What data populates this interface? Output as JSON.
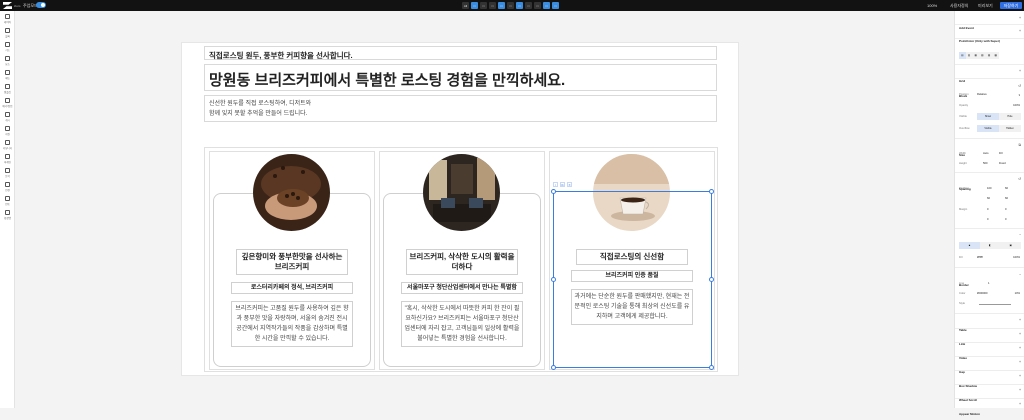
{
  "topbar": {
    "logo_text": "zium",
    "realtime_label": "주업모드",
    "devices": [
      "All",
      "□",
      "□",
      "□",
      "□",
      "□",
      "□",
      "□",
      "□",
      "□",
      "□"
    ],
    "zoom": "100%",
    "link_1": "사용자정의",
    "link_2": "미리보기",
    "publish": "저장하기"
  },
  "leftbar": {
    "items": [
      {
        "label": "레이어"
      },
      {
        "label": "블록"
      },
      {
        "label": "기능"
      },
      {
        "label": "요소"
      },
      {
        "label": "메뉴"
      },
      {
        "label": "템플릿"
      },
      {
        "label": "배너/팝업"
      },
      {
        "label": "게시"
      },
      {
        "label": "자원"
      },
      {
        "label": "커뮤니티"
      },
      {
        "label": "마케팅"
      },
      {
        "label": "분석"
      },
      {
        "label": "연결"
      },
      {
        "label": "연동"
      },
      {
        "label": "확장앱"
      }
    ]
  },
  "canvas": {
    "subtitle": "직접로스팅 원두, 풍부한 커피향을 선사합니다.",
    "headline": "망원동 브리즈커피에서 특별한 로스팅 경험을 만끽하세요.",
    "description_line1": "신선한 원두를 직접 로스팅하여, 디저트와",
    "description_line2": "함께 잊지 못할 추억을 만들어 드립니다.",
    "cards": [
      {
        "title": "깊은향미와 풍부한맛을 선사하는 브리즈커피",
        "subtitle": "로스터리카페의 정석, 브리즈커피",
        "body": "브리즈커피는 고품질 원두를 사용하여 깊은 향과 풍부한 맛을 자랑하며, 서울의 숨겨진 전시 공간에서 지역작가들의 작품을 감상하며 특별한 시간을 만끽할 수 있습니다."
      },
      {
        "title": "브리즈커피, 삭삭한 도시의 활력을 더하다",
        "subtitle": "서울마포구 청단산업센터에서 만나는 특별함",
        "body": "\"혹시, 삭삭한 도시에서 따뜻한 커피 한 잔이 필요하신가요? 브리즈커피는 서울마포구 청단산업센터에 자리 잡고, 고객님들의 일상에 활력을 불어넣는 특별한 경험을 선사합니다."
      },
      {
        "title": "직접로스팅의 신선함",
        "subtitle": "브리즈커피 인증 품질",
        "body": "과거에는 단순한 원두를 판매했지만, 현재는 전문적인 로스팅 기술을 통해 최상의 신선도를 유지하며 고객에게 제공합니다."
      }
    ],
    "selection_tools": [
      "↕",
      "⧉",
      "✕"
    ]
  },
  "rightbar": {
    "add_event": "Add Event",
    "point_color": "PointColor (Only with Super)",
    "alignment": "Alignment",
    "grid": "Grid",
    "block": "Block",
    "position_label": "Position",
    "position_value": "Relative",
    "opacity_label": "Opacity",
    "opacity_value": "100%",
    "visible_label": "Visible",
    "visible_show": "Show",
    "visible_hide": "Hide",
    "overflow_label": "Overflow",
    "overflow_visible": "Visible",
    "overflow_hidden": "Hidden",
    "size": "Size",
    "width_label": "Width",
    "width_value": "Auto",
    "width_unit": "Fill",
    "height_label": "Height",
    "height_value": "500",
    "height_unit": "Fixed",
    "spacing": "Spacing",
    "padding_label": "Padding",
    "padding_top": "100",
    "padding_side": "60",
    "margin_label": "Margin",
    "margin_value": "0",
    "background": "Background",
    "fill_label": "Fill",
    "fill_value": "#ffffff",
    "fill_opacity": "100%",
    "border": "Border",
    "border_line_label": "Line",
    "border_line_value": "1",
    "border_color_label": "Color",
    "border_color_value": "#000000",
    "border_opacity": "10%",
    "border_style_label": "Style",
    "table": "Table",
    "link": "Link",
    "video": "Video",
    "gap": "Gap",
    "box_shadow": "Box Shadow",
    "wheel_scroll": "Wheel Scroll",
    "appear_motion": "Appear Motion"
  }
}
